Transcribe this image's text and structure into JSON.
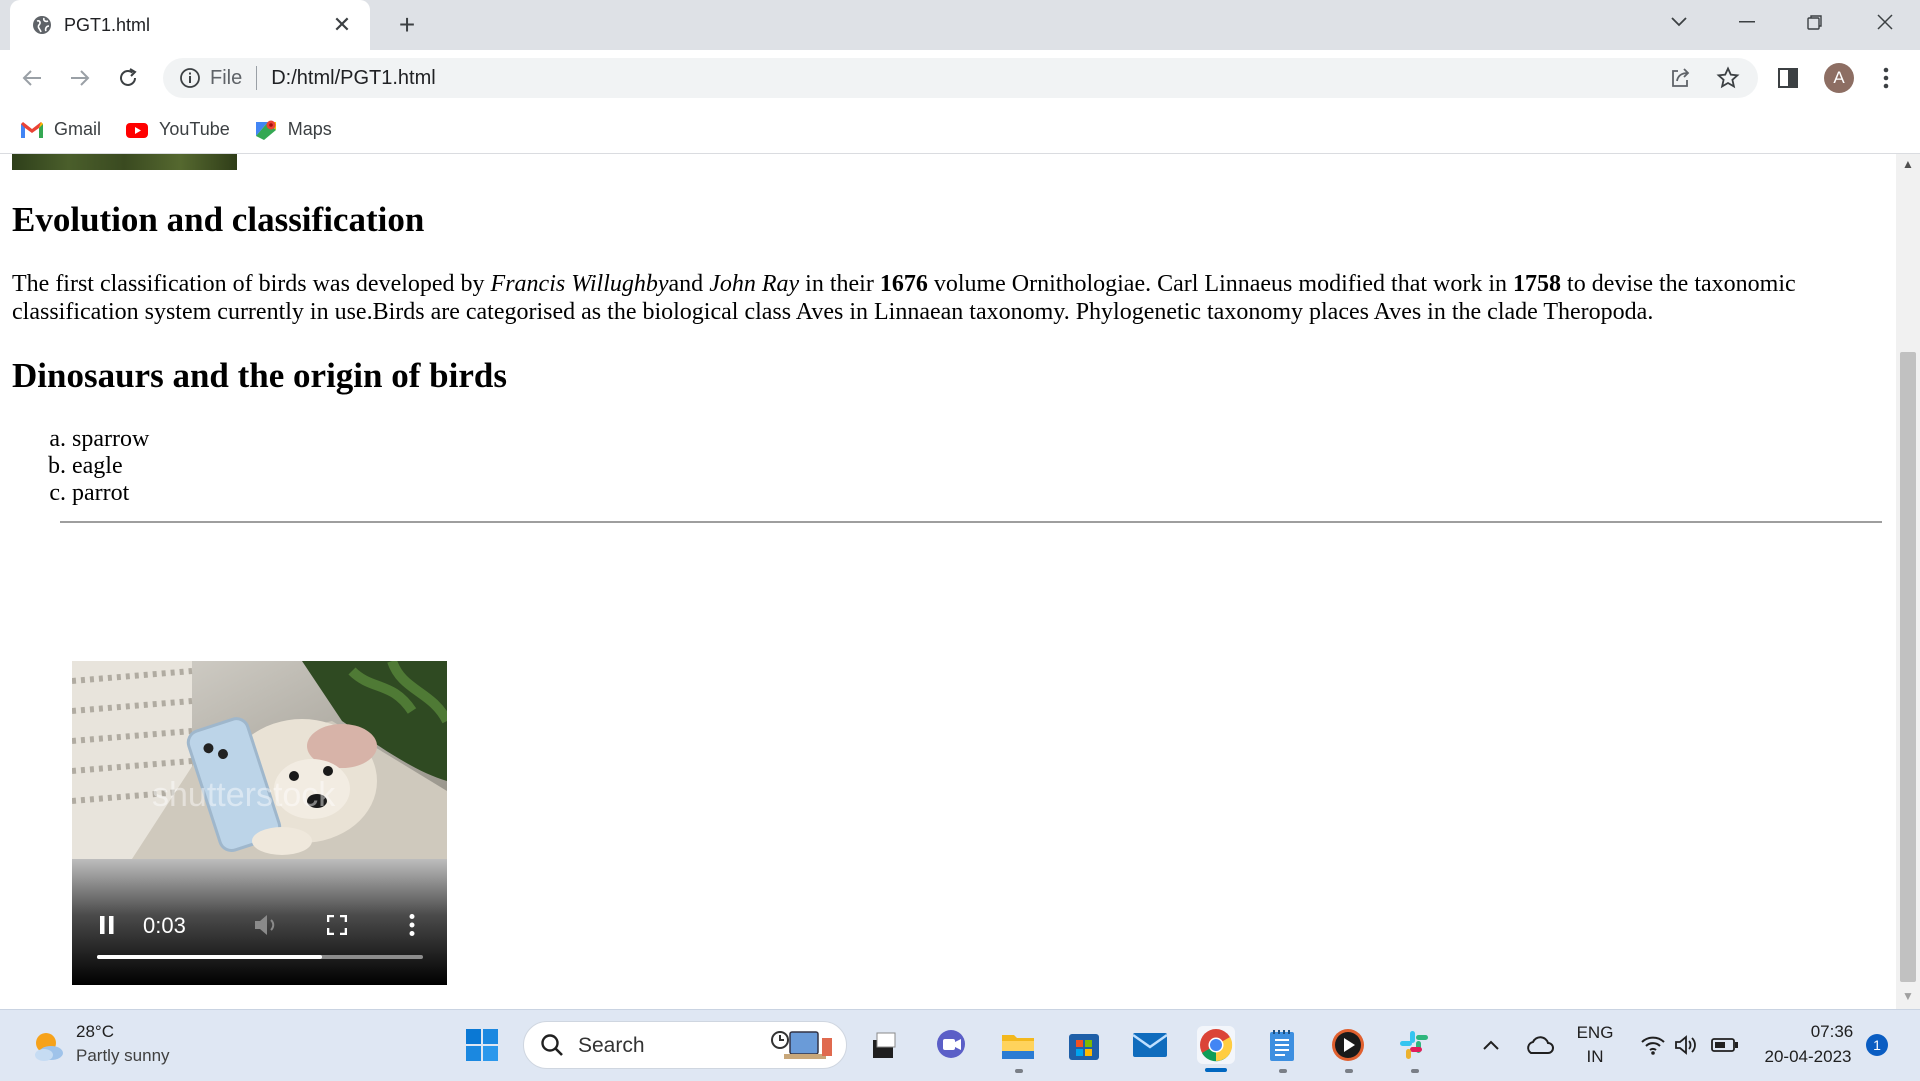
{
  "browser": {
    "tab_title": "PGT1.html",
    "close_glyph": "✕",
    "new_tab_glyph": "+",
    "address_scheme": "File",
    "address_url": "D:/html/PGT1.html",
    "avatar_letter": "A",
    "bookmarks": [
      {
        "label": "Gmail",
        "icon": "gmail-icon"
      },
      {
        "label": "YouTube",
        "icon": "youtube-icon"
      },
      {
        "label": "Maps",
        "icon": "maps-icon"
      }
    ]
  },
  "page": {
    "heading1": "Evolution and classification",
    "para": {
      "t1": "The first classification of birds was developed by ",
      "i1": "Francis Willughby",
      "t2": "and ",
      "i2": "John Ray",
      "t3": " in their ",
      "b1": "1676",
      "t4": " volume Ornithologiae. Carl Linnaeus modified that work in ",
      "b2": "1758",
      "t5": " to devise the taxonomic classification system currently in use.Birds are categorised as the biological class Aves in Linnaean taxonomy. Phylogenetic taxonomy places Aves in the clade Theropoda."
    },
    "heading2": "Dinosaurs and the origin of birds",
    "list": [
      "sparrow",
      "eagle",
      "parrot"
    ],
    "video": {
      "time": "0:03",
      "progress_fraction": 0.69,
      "watermark": "shutterstock"
    }
  },
  "taskbar": {
    "weather_temp": "28°C",
    "weather_desc": "Partly sunny",
    "search_label": "Search",
    "lang_line1": "ENG",
    "lang_line2": "IN",
    "time": "07:36",
    "date": "20-04-2023",
    "notification_count": "1"
  }
}
